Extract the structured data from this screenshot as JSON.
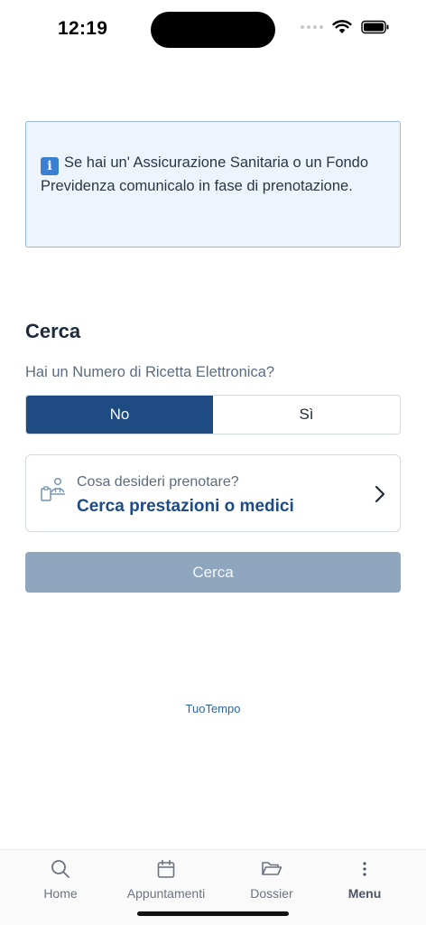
{
  "status_bar": {
    "time": "12:19"
  },
  "info_box": {
    "icon": "info-icon",
    "text": "Se hai un' Assicurazione Sanitaria o un Fondo Previdenza comunicalo in fase di prenotazione."
  },
  "search_section": {
    "title": "Cerca",
    "question": "Hai un Numero di Ricetta Elettronica?",
    "toggle": {
      "no": "No",
      "yes": "Sì",
      "selected": "No"
    },
    "card": {
      "subtitle": "Cosa desideri prenotare?",
      "title": "Cerca prestazioni o medici"
    },
    "button": "Cerca"
  },
  "brand": "TuoTempo",
  "tabs": [
    {
      "label": "Home",
      "icon": "search-icon"
    },
    {
      "label": "Appuntamenti",
      "icon": "calendar-icon"
    },
    {
      "label": "Dossier",
      "icon": "folder-open-icon"
    },
    {
      "label": "Menu",
      "icon": "more-vertical-icon"
    }
  ],
  "colors": {
    "primary": "#1d4b82",
    "disabled_button": "#8fa6bf",
    "info_bg": "#eef4fc",
    "info_border": "#9bb9dc"
  }
}
